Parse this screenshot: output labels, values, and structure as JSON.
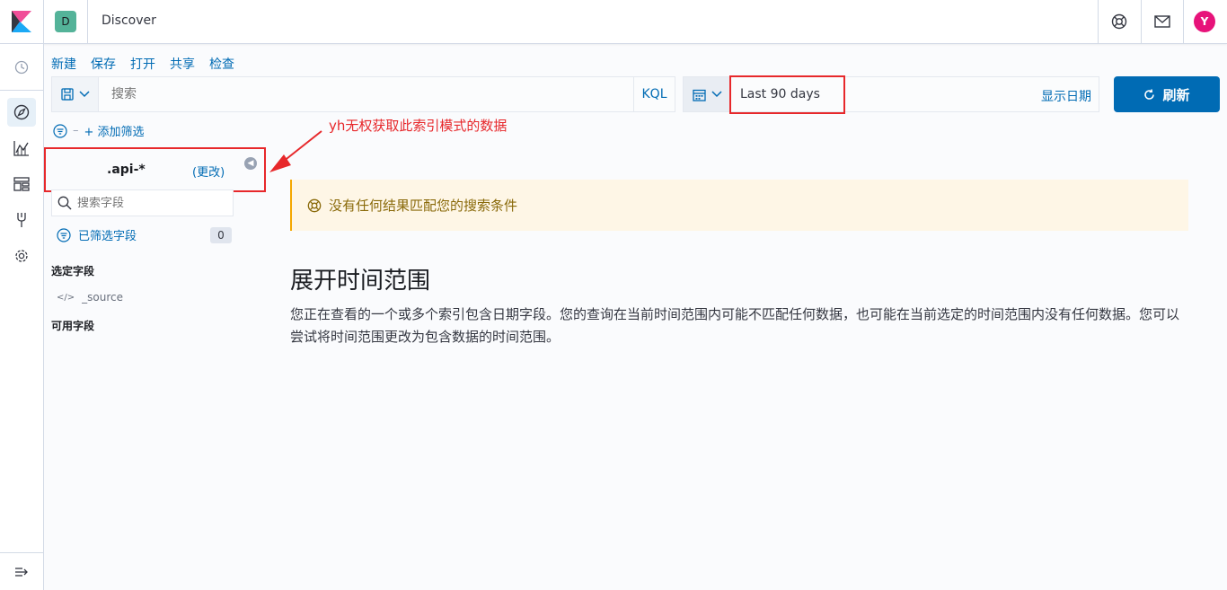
{
  "header": {
    "space_initial": "D",
    "app_title": "Discover",
    "user_initial": "Y"
  },
  "topmenu": {
    "new": "新建",
    "save": "保存",
    "open": "打开",
    "share": "共享",
    "inspect": "检查"
  },
  "query": {
    "placeholder": "搜索",
    "language": "KQL"
  },
  "date": {
    "range": "Last 90 days",
    "show_dates": "显示日期"
  },
  "refresh": {
    "label": "刷新"
  },
  "filters": {
    "add_filter": "+ 添加筛选"
  },
  "annotation": {
    "text": "yh无权获取此索引模式的数据"
  },
  "sidebar": {
    "index_pattern": ".api-*",
    "change_label": "(更改)",
    "search_placeholder": "搜索字段",
    "filtered_fields_label": "已筛选字段",
    "filtered_count": "0",
    "selected_fields_title": "选定字段",
    "selected_fields": [
      {
        "name": "_source"
      }
    ],
    "available_fields_title": "可用字段"
  },
  "main": {
    "no_results": "没有任何结果匹配您的搜索条件",
    "expand_title": "展开时间范围",
    "expand_desc": "您正在查看的一个或多个索引包含日期字段。您的查询在当前时间范围内可能不匹配任何数据，也可能在当前选定的时间范围内没有任何数据。您可以尝试将时间范围更改为包含数据的时间范围。"
  },
  "colors": {
    "primary": "#006bb4",
    "annotation_red": "#e7282b",
    "warning": "#f5a700",
    "avatar": "#e7137a",
    "space": "#54b399"
  },
  "icons": {
    "logo": "kibana-logo-icon",
    "help": "help-lifebuoy-icon",
    "mail": "mail-icon",
    "recent": "clock-icon",
    "discover": "compass-icon",
    "visualize": "chart-icon",
    "dashboard": "dashboard-icon",
    "devtools": "wrench-icon",
    "management": "gear-icon",
    "collapse": "collapse-nav-icon"
  }
}
